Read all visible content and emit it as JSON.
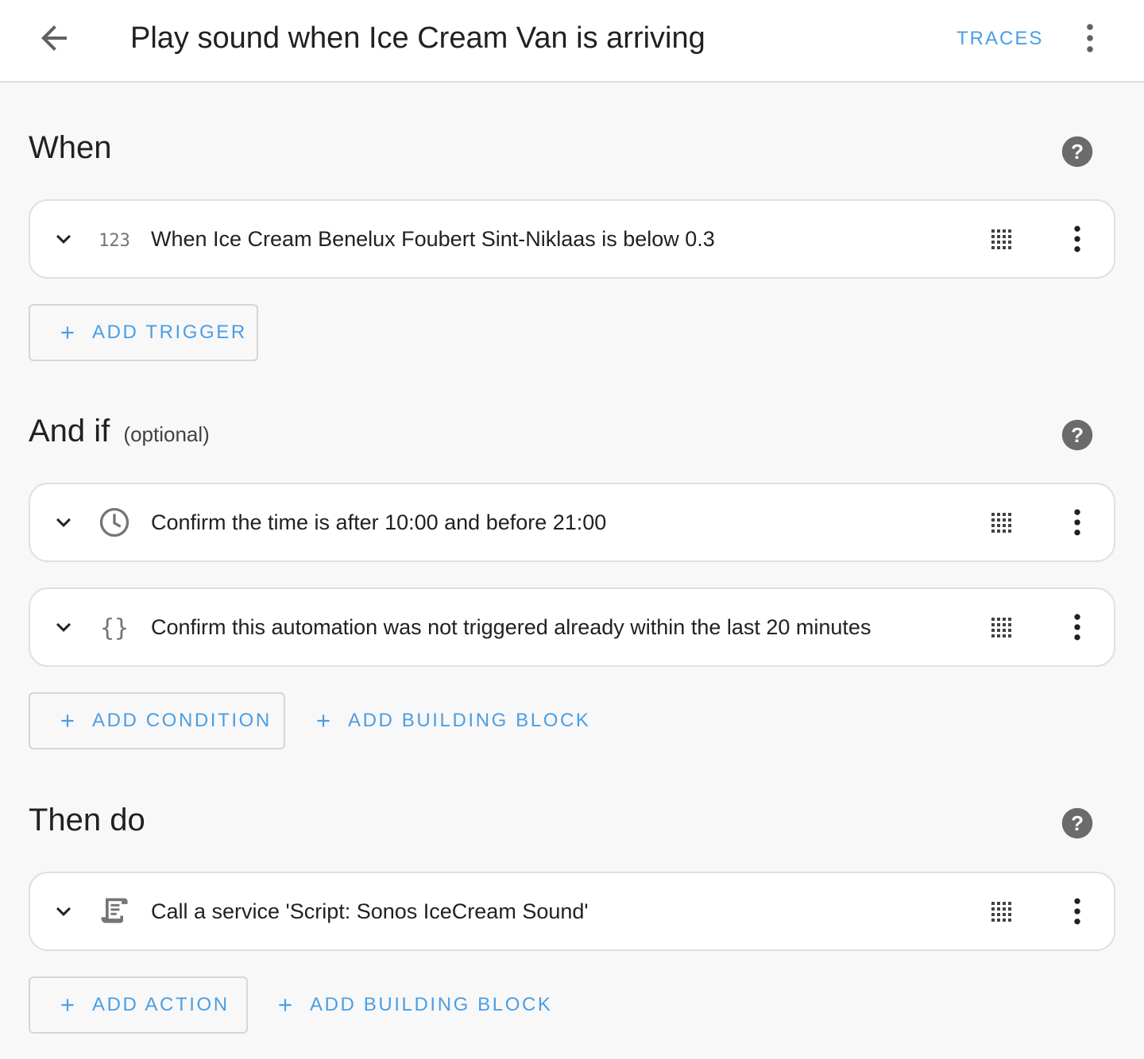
{
  "header": {
    "title": "Play sound when Ice Cream Van is arriving",
    "traces_label": "TRACES"
  },
  "sections": {
    "when": {
      "title": "When",
      "items": [
        {
          "icon": "numeric-icon",
          "icon_text": "123",
          "label": "When Ice Cream Benelux Foubert Sint-Niklaas is below 0.3"
        }
      ],
      "add_label": "ADD TRIGGER"
    },
    "and_if": {
      "title": "And if",
      "optional": "(optional)",
      "items": [
        {
          "icon": "clock-icon",
          "label": "Confirm the time is after 10:00 and before 21:00"
        },
        {
          "icon": "code-braces-icon",
          "icon_text": "{}",
          "label": "Confirm this automation was not triggered already within the last 20 minutes"
        }
      ],
      "add_label": "ADD CONDITION",
      "building_block_label": "ADD BUILDING BLOCK"
    },
    "then_do": {
      "title": "Then do",
      "items": [
        {
          "icon": "script-icon",
          "label": "Call a service 'Script: Sonos IceCream Sound'"
        }
      ],
      "add_label": "ADD ACTION",
      "building_block_label": "ADD BUILDING BLOCK"
    }
  },
  "colors": {
    "accent": "#4a9ee6",
    "background": "#f8f8f8",
    "icon_gray": "#757575"
  }
}
